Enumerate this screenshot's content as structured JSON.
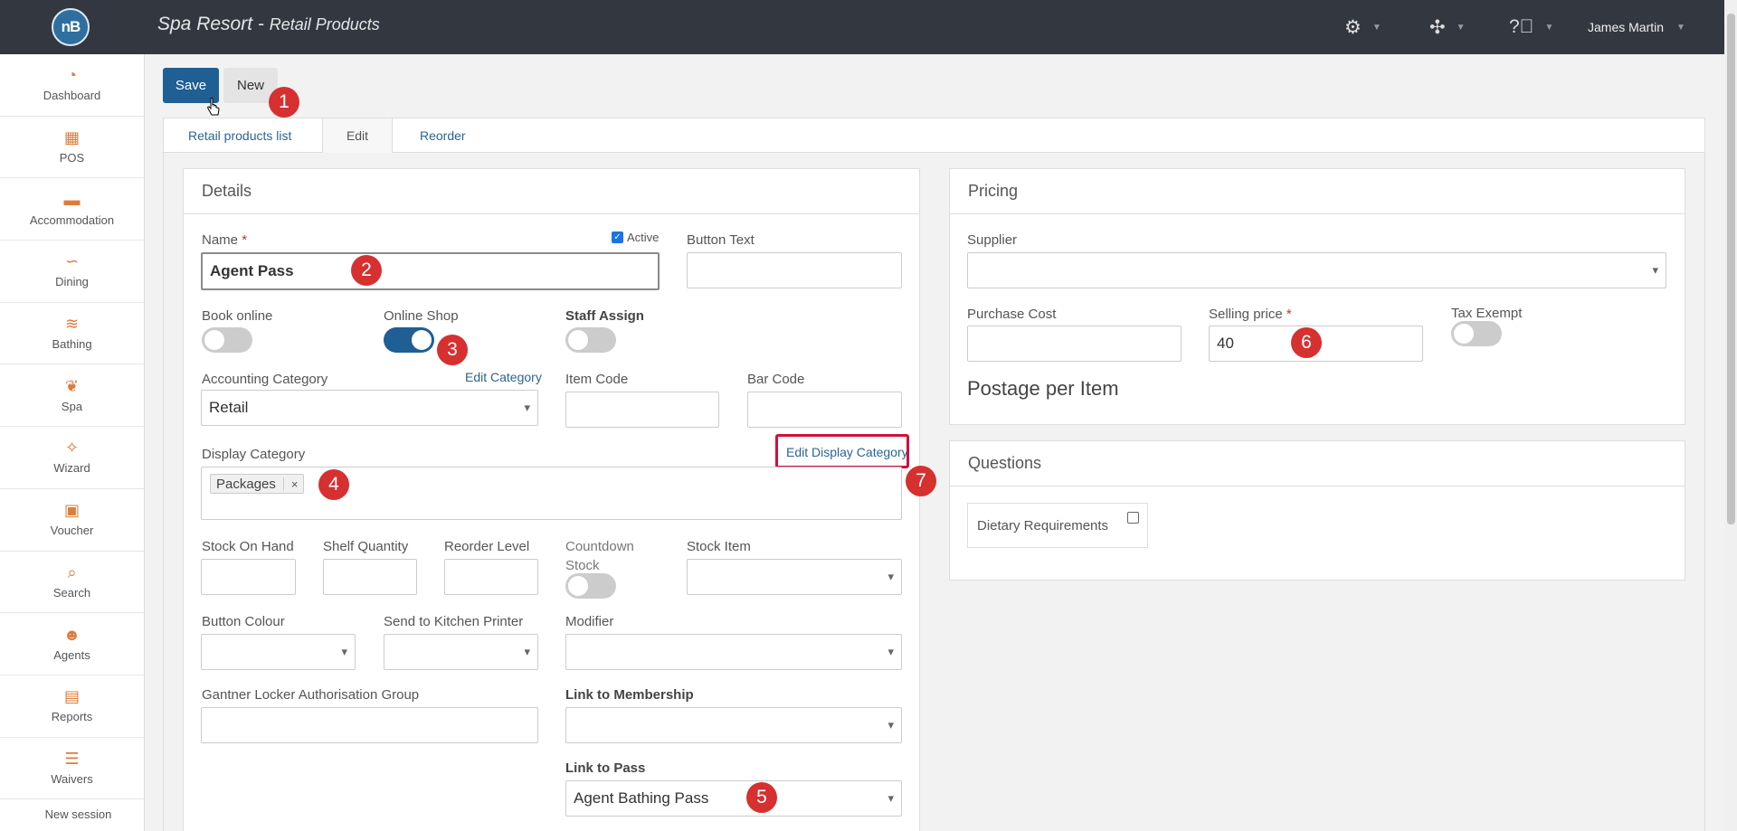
{
  "header": {
    "logo_text": "nB",
    "app_name": "Spa Resort - ",
    "page_name": "Retail Products",
    "user_name": "James Martin"
  },
  "sidebar": {
    "items": [
      {
        "label": "Dashboard",
        "icon": "◔"
      },
      {
        "label": "POS",
        "icon": "▦"
      },
      {
        "label": "Accommodation",
        "icon": "▬"
      },
      {
        "label": "Dining",
        "icon": "∽"
      },
      {
        "label": "Bathing",
        "icon": "≋"
      },
      {
        "label": "Spa",
        "icon": "❦"
      },
      {
        "label": "Wizard",
        "icon": "✧"
      },
      {
        "label": "Voucher",
        "icon": "▣"
      },
      {
        "label": "Search",
        "icon": "⌕"
      },
      {
        "label": "Agents",
        "icon": "☻"
      },
      {
        "label": "Reports",
        "icon": "▤"
      },
      {
        "label": "Waivers",
        "icon": "☰"
      }
    ],
    "bottom": "New session"
  },
  "toolbar": {
    "save": "Save",
    "new": "New"
  },
  "tabs": [
    "Retail products list",
    "Edit",
    "Reorder"
  ],
  "details": {
    "title": "Details",
    "active_label": "Active",
    "name_label": "Name",
    "name_value": "Agent Pass",
    "button_text_label": "Button Text",
    "book_online_label": "Book online",
    "online_shop_label": "Online Shop",
    "staff_assign_label": "Staff Assign",
    "accounting_category_label": "Accounting Category",
    "edit_category_link": "Edit Category",
    "accounting_category_value": "Retail",
    "item_code_label": "Item Code",
    "bar_code_label": "Bar Code",
    "display_category_label": "Display Category",
    "edit_display_category_link": "Edit Display Category",
    "display_category_chip": "Packages",
    "chip_remove": "×",
    "stock_on_hand_label": "Stock On Hand",
    "shelf_quantity_label": "Shelf Quantity",
    "reorder_level_label": "Reorder Level",
    "countdown_stock_label_1": "Countdown",
    "countdown_stock_label_2": "Stock",
    "stock_item_label": "Stock Item",
    "button_colour_label": "Button Colour",
    "kitchen_printer_label": "Send to Kitchen Printer",
    "modifier_label": "Modifier",
    "gantner_label": "Gantner Locker Authorisation Group",
    "link_membership_label": "Link to Membership",
    "link_pass_label": "Link to Pass",
    "link_pass_value": "Agent Bathing Pass"
  },
  "pricing": {
    "title": "Pricing",
    "supplier_label": "Supplier",
    "purchase_cost_label": "Purchase Cost",
    "selling_price_label": "Selling price",
    "selling_price_value": "40",
    "tax_exempt_label": "Tax Exempt",
    "postage_label": "Postage per Item"
  },
  "questions": {
    "title": "Questions",
    "dietary_label": "Dietary Requirements"
  },
  "badges": [
    "1",
    "2",
    "3",
    "4",
    "5",
    "6",
    "7"
  ],
  "required_mark": "*",
  "colors": {
    "header_bg": "#333840",
    "accent": "#1f5f94",
    "nav_icon": "#e07b39",
    "badge": "#d63030",
    "highlight": "#d0103a"
  }
}
